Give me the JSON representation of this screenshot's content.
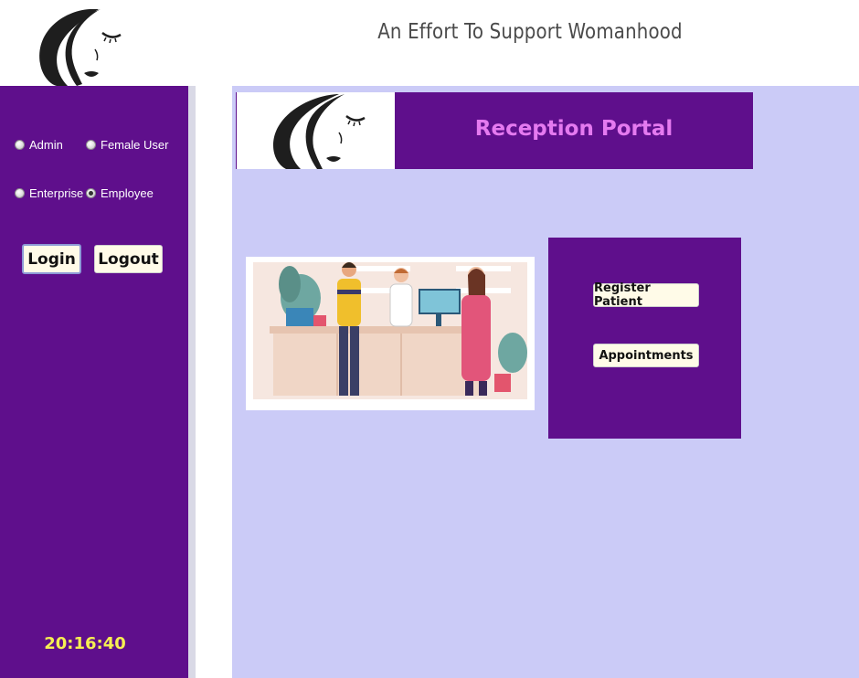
{
  "header": {
    "title": "An Effort To Support Womanhood",
    "logo_icon": "woman-face-logo-icon"
  },
  "sidebar": {
    "roles": [
      {
        "label": "Admin",
        "checked": false
      },
      {
        "label": "Female User",
        "checked": false
      },
      {
        "label": "Enterprise",
        "checked": false
      },
      {
        "label": "Employee",
        "checked": true
      }
    ],
    "login_label": "Login",
    "logout_label": "Logout",
    "clock": "20:16:40"
  },
  "main": {
    "portal_title": "Reception Portal",
    "illustration": "reception-desk-illustration",
    "actions": {
      "register_patient_label": "Register Patient",
      "appointments_label": "Appointments"
    }
  },
  "colors": {
    "sidebar_bg": "#5f0f8c",
    "main_bg": "#cbcbf7",
    "portal_title": "#e57af0",
    "clock": "#f6ef52",
    "button_bg": "#fffbe8"
  }
}
